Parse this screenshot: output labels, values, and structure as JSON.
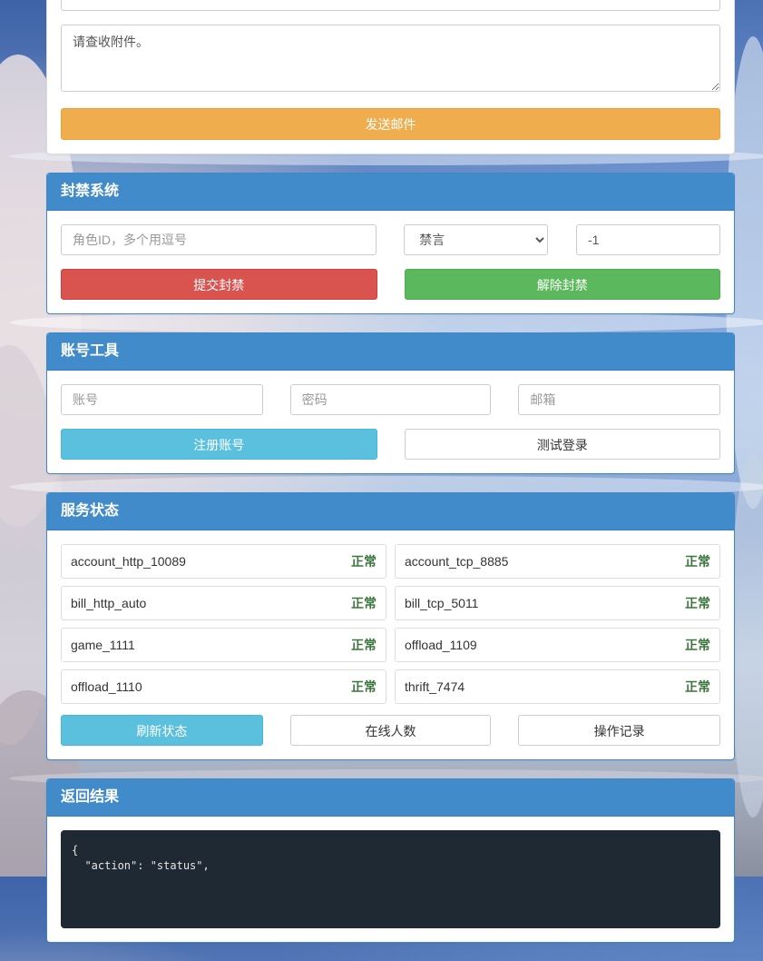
{
  "mail": {
    "body_value": "请查收附件。",
    "send_label": "发送邮件"
  },
  "ban": {
    "title": "封禁系统",
    "role_placeholder": "角色ID，多个用逗号",
    "type_options": [
      "禁言"
    ],
    "type_selected": "禁言",
    "duration_value": "-1",
    "submit_label": "提交封禁",
    "unban_label": "解除封禁"
  },
  "account": {
    "title": "账号工具",
    "user_placeholder": "账号",
    "password_placeholder": "密码",
    "email_placeholder": "邮箱",
    "register_label": "注册账号",
    "test_login_label": "测试登录"
  },
  "services": {
    "title": "服务状态",
    "items": [
      {
        "name": "account_http_10089",
        "state": "正常"
      },
      {
        "name": "account_tcp_8885",
        "state": "正常"
      },
      {
        "name": "bill_http_auto",
        "state": "正常"
      },
      {
        "name": "bill_tcp_5011",
        "state": "正常"
      },
      {
        "name": "game_1111",
        "state": "正常"
      },
      {
        "name": "offload_1109",
        "state": "正常"
      },
      {
        "name": "offload_1110",
        "state": "正常"
      },
      {
        "name": "thrift_7474",
        "state": "正常"
      }
    ],
    "refresh_label": "刷新状态",
    "online_label": "在线人数",
    "log_label": "操作记录"
  },
  "result": {
    "title": "返回结果",
    "output": "{\n  \"action\": \"status\","
  }
}
